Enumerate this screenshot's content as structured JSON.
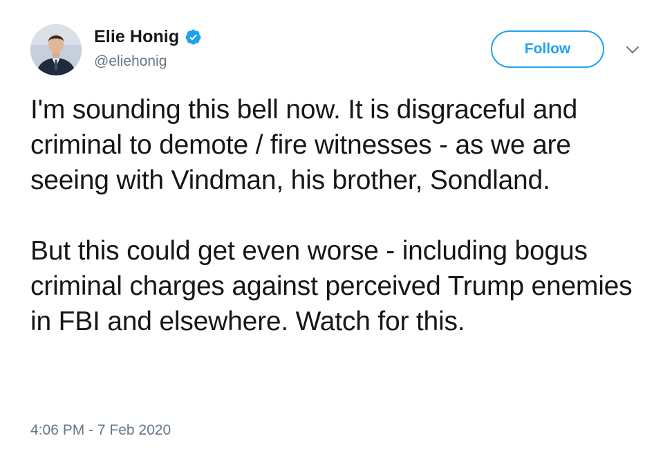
{
  "author": {
    "display_name": "Elie Honig",
    "handle": "@eliehonig",
    "verified": true
  },
  "actions": {
    "follow_label": "Follow"
  },
  "tweet": {
    "paragraphs": [
      "I'm sounding this bell now. It is disgraceful and criminal to demote / fire witnesses - as we are seeing with Vindman, his brother, Sondland.",
      "But this could get even worse - including bogus criminal charges against perceived Trump enemies in FBI and elsewhere. Watch for this."
    ],
    "timestamp": "4:06 PM - 7 Feb 2020"
  },
  "icons": {
    "verified": "verified-badge-icon",
    "more": "chevron-down-icon"
  },
  "colors": {
    "accent": "#1da1f2",
    "text": "#14171a",
    "secondary": "#657786"
  }
}
